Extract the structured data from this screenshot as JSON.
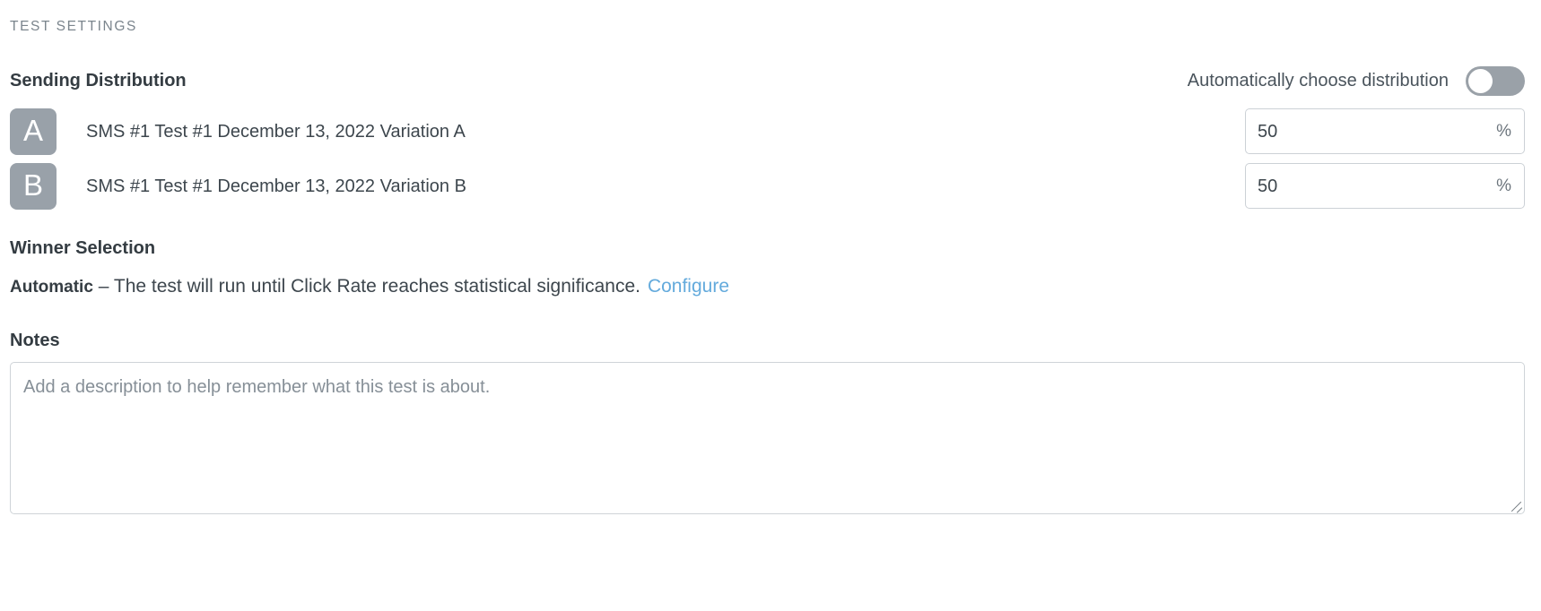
{
  "section": {
    "header": "TEST SETTINGS"
  },
  "sending_distribution": {
    "title": "Sending Distribution",
    "auto_label": "Automatically choose distribution",
    "toggle_state": "off",
    "toggle_icon": "toggle-off-icon",
    "variations": [
      {
        "badge": "A",
        "label": "SMS #1 Test #1 December 13, 2022 Variation A",
        "percent": "50",
        "suffix": "%"
      },
      {
        "badge": "B",
        "label": "SMS #1 Test #1 December 13, 2022 Variation B",
        "percent": "50",
        "suffix": "%"
      }
    ]
  },
  "winner_selection": {
    "title": "Winner Selection",
    "mode": "Automatic",
    "description": "– The test will run until Click Rate reaches statistical significance.",
    "configure_link": "Configure"
  },
  "notes": {
    "label": "Notes",
    "placeholder": "Add a description to help remember what this test is about.",
    "value": "",
    "resize_icon": "resize-handle-icon"
  },
  "colors": {
    "badge_grey": "#99a1a9",
    "toggle_track": "#9aa1a8",
    "link_blue": "#63aadc",
    "border": "#ccd1d6",
    "text_primary": "#3d464d",
    "text_muted": "#7b858d"
  }
}
